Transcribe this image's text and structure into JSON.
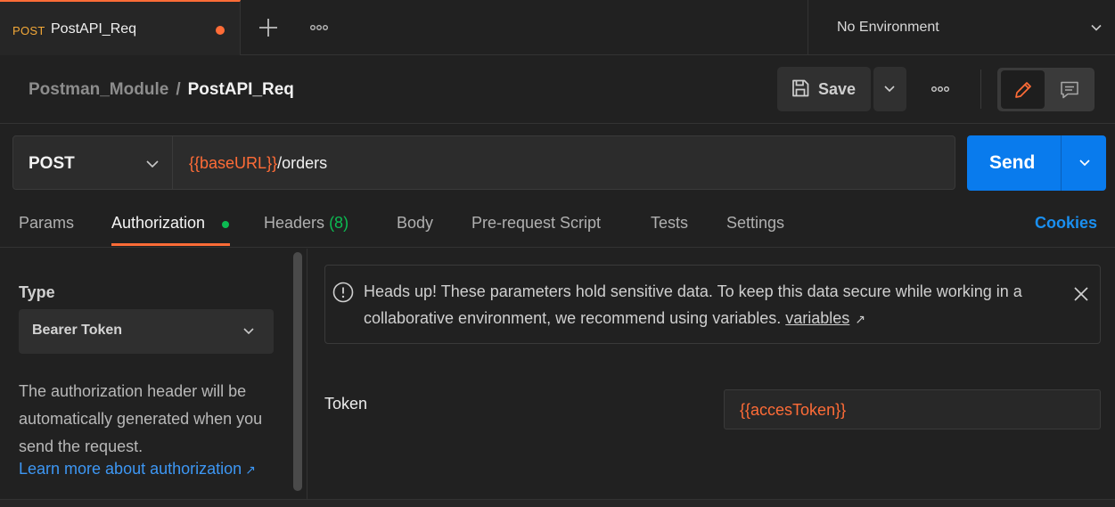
{
  "tab": {
    "method": "POST",
    "name": "PostAPI_Req"
  },
  "environment": {
    "label": "No Environment"
  },
  "breadcrumb": {
    "parent": "Postman_Module",
    "separator": "/",
    "current": "PostAPI_Req"
  },
  "toolbar": {
    "save_label": "Save"
  },
  "request": {
    "method": "POST",
    "url_variable": "{{baseURL}}",
    "url_path": "/orders",
    "send_label": "Send"
  },
  "subtabs": {
    "params": "Params",
    "authorization": "Authorization",
    "headers": "Headers",
    "headers_count": "(8)",
    "body": "Body",
    "prerequest": "Pre-request Script",
    "tests": "Tests",
    "settings": "Settings",
    "cookies": "Cookies"
  },
  "auth": {
    "type_label": "Type",
    "type_value": "Bearer Token",
    "description": "The authorization header will be automatically generated when you send the request.",
    "learn_more": "Learn more about authorization",
    "notice_text": "Heads up! These parameters hold sensitive data. To keep this data secure while working in a collaborative environment, we recommend using variables.",
    "notice_link": "variables",
    "token_label": "Token",
    "token_value": "{{accesToken}}"
  },
  "colors": {
    "accent": "#ff6c37",
    "primary": "#097bed",
    "link": "#3d97f4",
    "success": "#0cbb52",
    "method_post": "#f4a938"
  }
}
